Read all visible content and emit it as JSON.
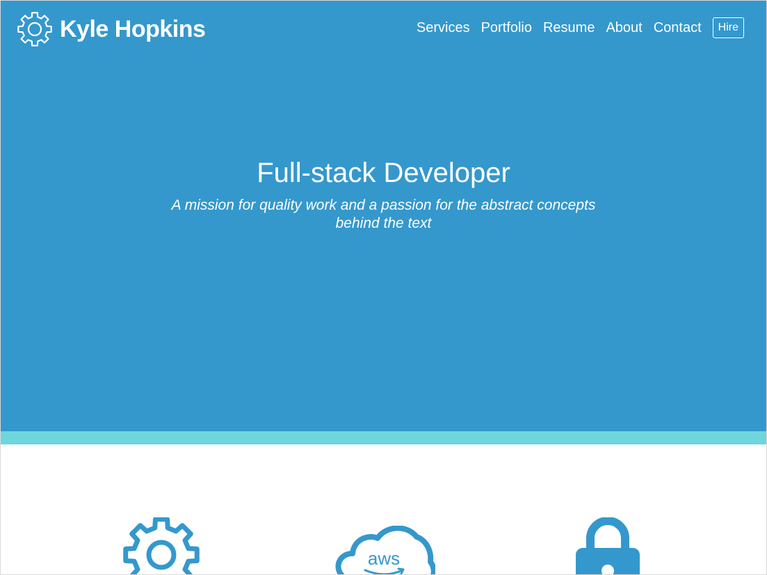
{
  "header": {
    "brand_name": "Kyle Hopkins",
    "brand_icon": "gear-icon",
    "nav": [
      {
        "label": "Services"
      },
      {
        "label": "Portfolio"
      },
      {
        "label": "Resume"
      },
      {
        "label": "About"
      },
      {
        "label": "Contact"
      }
    ],
    "hire_label": "Hire"
  },
  "hero": {
    "title": "Full-stack Developer",
    "subtitle": "A mission for quality work and a passion for the abstract concepts behind the text"
  },
  "services": {
    "icons": [
      "gear-icon",
      "aws-cloud-icon",
      "lock-icon"
    ],
    "aws_text": "aws"
  },
  "colors": {
    "hero_bg": "#3498cd",
    "accent_stripe": "#6ed6dc",
    "icon_blue": "#3498cd"
  }
}
